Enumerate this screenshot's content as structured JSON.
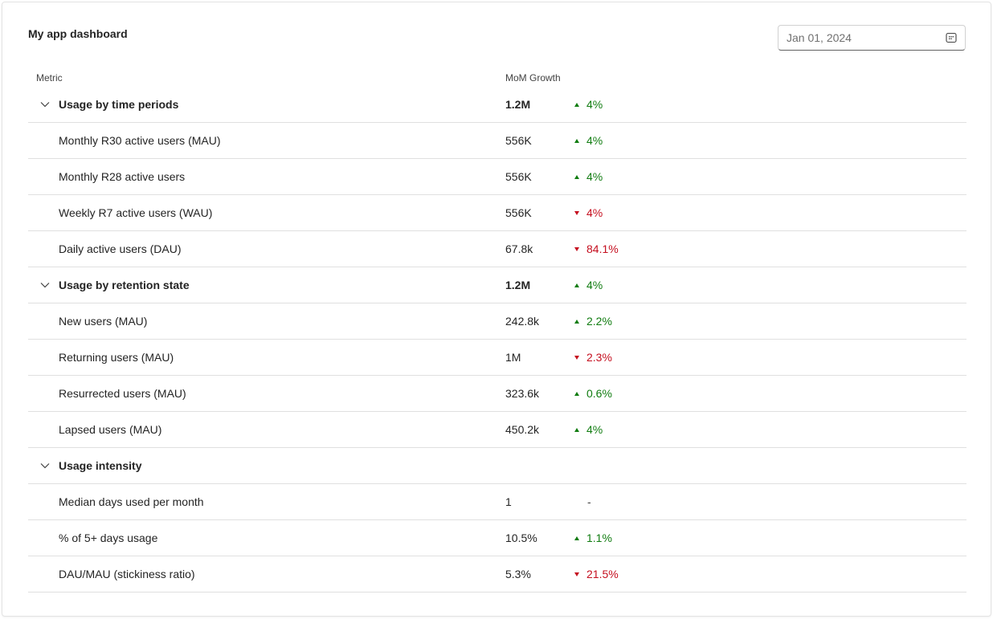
{
  "header": {
    "title": "My app dashboard",
    "date_value": "Jan 01, 2024",
    "date_icon": "calendar-icon"
  },
  "table": {
    "columns": [
      "Metric",
      "MoM Growth"
    ],
    "groups": [
      {
        "label": "Usage by time periods",
        "value": "1.2M",
        "growth": "4%",
        "trend": "up",
        "items": [
          {
            "label": "Monthly R30 active users (MAU)",
            "value": "556K",
            "growth": "4%",
            "trend": "up"
          },
          {
            "label": "Monthly R28 active users",
            "value": "556K",
            "growth": "4%",
            "trend": "up"
          },
          {
            "label": "Weekly R7 active users (WAU)",
            "value": "556K",
            "growth": "4%",
            "trend": "down"
          },
          {
            "label": "Daily active users (DAU)",
            "value": "67.8k",
            "growth": "84.1%",
            "trend": "down"
          }
        ]
      },
      {
        "label": "Usage by retention state",
        "value": "1.2M",
        "growth": "4%",
        "trend": "up",
        "items": [
          {
            "label": "New users (MAU)",
            "value": "242.8k",
            "growth": "2.2%",
            "trend": "up"
          },
          {
            "label": "Returning users (MAU)",
            "value": "1M",
            "growth": "2.3%",
            "trend": "down"
          },
          {
            "label": "Resurrected users (MAU)",
            "value": "323.6k",
            "growth": "0.6%",
            "trend": "up"
          },
          {
            "label": "Lapsed users (MAU)",
            "value": "450.2k",
            "growth": "4%",
            "trend": "up"
          }
        ]
      },
      {
        "label": "Usage intensity",
        "value": "",
        "growth": "",
        "trend": "none",
        "items": [
          {
            "label": "Median days used per month",
            "value": "1",
            "growth": "-",
            "trend": "flat"
          },
          {
            "label": "% of 5+ days usage",
            "value": "10.5%",
            "growth": "1.1%",
            "trend": "up"
          },
          {
            "label": "DAU/MAU (stickiness ratio)",
            "value": "5.3%",
            "growth": "21.5%",
            "trend": "down"
          }
        ]
      }
    ]
  },
  "colors": {
    "up": "#107c10",
    "down": "#c50f1f",
    "border": "#e0e0e0"
  }
}
